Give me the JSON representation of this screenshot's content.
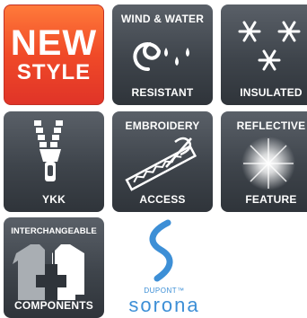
{
  "tiles": {
    "new_style": {
      "line1": "NEW",
      "line2": "STYLE",
      "bg_color": "#f04a28"
    },
    "wind_water": {
      "top_label": "WIND & WATER",
      "bottom_label": "RESISTANT",
      "icon": "wind-water-icon"
    },
    "insulated": {
      "bottom_label": "INSULATED",
      "icon": "snowflakes-icon"
    },
    "ykk": {
      "bottom_label": "YKK",
      "icon": "zipper-icon"
    },
    "embroidery": {
      "top_label": "EMBROIDERY",
      "bottom_label": "ACCESS",
      "icon": "embroidery-needle-icon"
    },
    "reflective": {
      "top_label": "REFLECTIVE",
      "bottom_label": "FEATURE",
      "icon": "light-burst-icon"
    },
    "interchangeable": {
      "top_label": "INTERCHANGEABLE",
      "bottom_label": "COMPONENTS",
      "icon": "jackets-plus-icon"
    }
  },
  "sorona_logo": {
    "brand": "DUPONT™",
    "name": "sorona",
    "color": "#3d8fd6"
  }
}
